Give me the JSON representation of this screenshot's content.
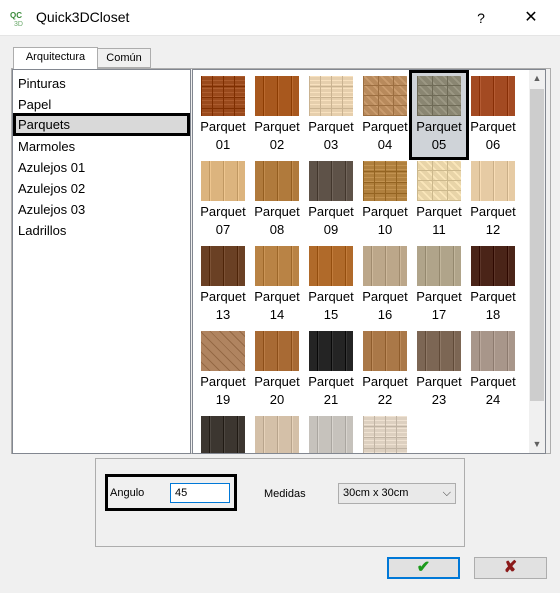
{
  "window": {
    "title": "Quick3DCloset",
    "help_label": "?",
    "close_label": "✕",
    "icon_text": "QC"
  },
  "tabs": [
    {
      "label": "Arquitectura",
      "active": true
    },
    {
      "label": "Común",
      "active": false
    }
  ],
  "categories": [
    {
      "label": "Pinturas"
    },
    {
      "label": "Papel"
    },
    {
      "label": "Parquets",
      "selected": true
    },
    {
      "label": "Marmoles"
    },
    {
      "label": "Azulejos 01"
    },
    {
      "label": "Azulejos 02"
    },
    {
      "label": "Azulejos 03"
    },
    {
      "label": "Ladrillos"
    }
  ],
  "textures": [
    {
      "word": "Parquet",
      "num": "01",
      "color": "#9a4a1c",
      "pattern": "checker"
    },
    {
      "word": "Parquet",
      "num": "02",
      "color": "#a8581e",
      "pattern": "planks"
    },
    {
      "word": "Parquet",
      "num": "03",
      "color": "#e6cfad",
      "pattern": "checker"
    },
    {
      "word": "Parquet",
      "num": "04",
      "color": "#b88a5c",
      "pattern": "herring"
    },
    {
      "word": "Parquet",
      "num": "05",
      "color": "#8a8672",
      "pattern": "herring",
      "selected": true
    },
    {
      "word": "Parquet",
      "num": "06",
      "color": "#a34a22",
      "pattern": "planks"
    },
    {
      "word": "Parquet",
      "num": "07",
      "color": "#dcb47e",
      "pattern": "planks"
    },
    {
      "word": "Parquet",
      "num": "08",
      "color": "#b07a3c",
      "pattern": "planks"
    },
    {
      "word": "Parquet",
      "num": "09",
      "color": "#5e5248",
      "pattern": "planks"
    },
    {
      "word": "Parquet",
      "num": "10",
      "color": "#b0803e",
      "pattern": "checker"
    },
    {
      "word": "Parquet",
      "num": "11",
      "color": "#e8d4a8",
      "pattern": "herring"
    },
    {
      "word": "Parquet",
      "num": "12",
      "color": "#e6cba4",
      "pattern": "planks"
    },
    {
      "word": "Parquet",
      "num": "13",
      "color": "#6a4024",
      "pattern": "planks"
    },
    {
      "word": "Parquet",
      "num": "14",
      "color": "#b98345",
      "pattern": "planks"
    },
    {
      "word": "Parquet",
      "num": "15",
      "color": "#b06a2a",
      "pattern": "planks"
    },
    {
      "word": "Parquet",
      "num": "16",
      "color": "#bca78a",
      "pattern": "planks"
    },
    {
      "word": "Parquet",
      "num": "17",
      "color": "#b0a48a",
      "pattern": "planks"
    },
    {
      "word": "Parquet",
      "num": "18",
      "color": "#4a2418",
      "pattern": "planks"
    },
    {
      "word": "Parquet",
      "num": "19",
      "color": "#b08460",
      "pattern": "diamond"
    },
    {
      "word": "Parquet",
      "num": "20",
      "color": "#a86a34",
      "pattern": "planks"
    },
    {
      "word": "Parquet",
      "num": "21",
      "color": "#242424",
      "pattern": "planks"
    },
    {
      "word": "Parquet",
      "num": "22",
      "color": "#aa7848",
      "pattern": "planks"
    },
    {
      "word": "Parquet",
      "num": "23",
      "color": "#7c6654",
      "pattern": "planks"
    },
    {
      "word": "Parquet",
      "num": "24",
      "color": "#a8968a",
      "pattern": "planks"
    },
    {
      "word": "",
      "num": "",
      "color": "#3c3630",
      "pattern": "planks"
    },
    {
      "word": "",
      "num": "",
      "color": "#d4c0a8",
      "pattern": "planks"
    },
    {
      "word": "",
      "num": "",
      "color": "#c6c2bc",
      "pattern": "planks"
    },
    {
      "word": "",
      "num": "",
      "color": "#ddd0c0",
      "pattern": "checker"
    }
  ],
  "settings": {
    "angulo_label": "Angulo",
    "angulo_value": "45",
    "medidas_label": "Medidas",
    "medidas_value": "30cm x 30cm"
  },
  "buttons": {
    "ok": "✔",
    "cancel": "✘"
  },
  "colors": {
    "accent": "#0078d7",
    "ok": "#1c9a1c",
    "cancel": "#8b1a1a"
  }
}
